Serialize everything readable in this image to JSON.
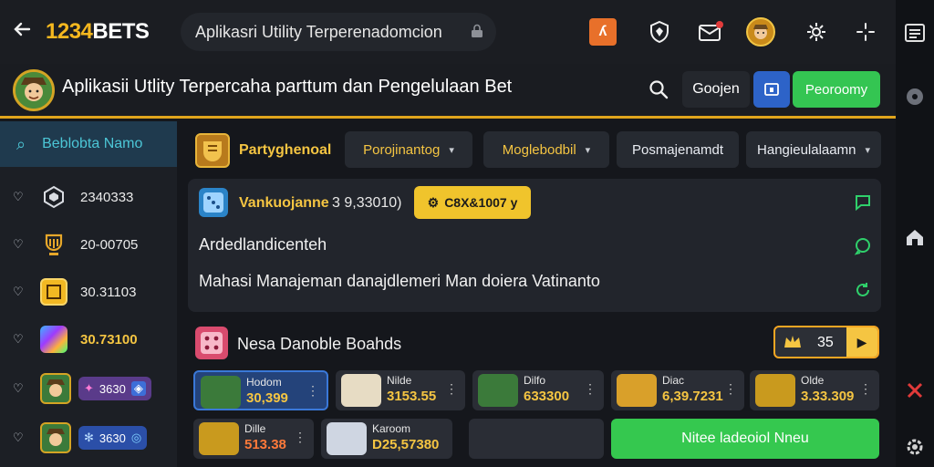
{
  "topbar": {
    "brand_num": "1234",
    "brand_txt": "BETS",
    "search_text": "Aplikasri Utility Terperenadomcion",
    "icons": [
      "back-arrow-icon",
      "lock-icon",
      "orange-app-icon",
      "shield-icon",
      "inbox-icon",
      "character-avatar-icon",
      "gear-icon",
      "sparkle-icon"
    ]
  },
  "header": {
    "title": "Aplikasii Utlity Terpercaha parttum dan Pengelulaan Bet",
    "login_label": "Goojen",
    "register_label": "Peoroomy"
  },
  "sidebar": {
    "active_label": "Beblobta Namo",
    "items": [
      {
        "value": "2340333"
      },
      {
        "value": "20-00705"
      },
      {
        "value": "30.31103"
      },
      {
        "value": "30.73100"
      },
      {
        "value": "3630"
      },
      {
        "value": "3630"
      }
    ]
  },
  "filters": {
    "title": "Partyghenoal",
    "drop1": "Porojinantog",
    "drop2": "Moglebodbil",
    "drop3": "Posmajenamdt",
    "drop4": "Hangieulalaamn"
  },
  "panel": {
    "name": "Vankuojanne",
    "stat": "3 9,33010)",
    "chip": "C8X&1007 y",
    "line1": "Ardedlandicenteh",
    "line2": "Mahasi Manajeman danajdlemeri Man doiera Vatinanto"
  },
  "boards": {
    "title": "Nesa Danoble Boahds",
    "count": "35",
    "cards": [
      {
        "label": "Hodom",
        "value": "30,399"
      },
      {
        "label": "Nilde",
        "value": "3153.55"
      },
      {
        "label": "Dilfo",
        "value": "633300"
      },
      {
        "label": "Diac",
        "value": "6,39.7231"
      },
      {
        "label": "Olde",
        "value": "3.33.309"
      },
      {
        "label": "Dille",
        "value": "513.38"
      },
      {
        "label": "Karoom",
        "value": "D25,57380"
      }
    ],
    "cta": "Nitee ladeoiol Nneu"
  },
  "colors": {
    "accent_gold": "#f5c542",
    "accent_green": "#35c84f",
    "accent_blue": "#2d63c8",
    "accent_orange": "#e8702a"
  }
}
